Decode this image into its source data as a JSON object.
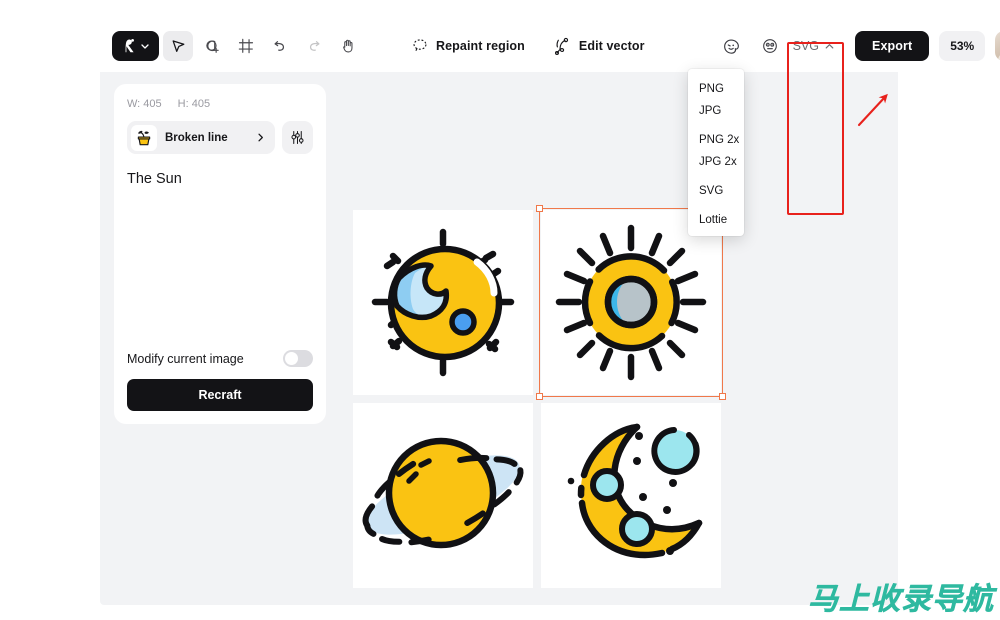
{
  "toolbar": {
    "logo_name": "recraft-logo",
    "tools": [
      {
        "name": "select-tool",
        "title": "Select",
        "active": true
      },
      {
        "name": "shape-tool",
        "title": "Add shape",
        "active": false
      },
      {
        "name": "frame-tool",
        "title": "Frame",
        "active": false
      },
      {
        "name": "undo-tool",
        "title": "Undo",
        "active": false
      },
      {
        "name": "redo-tool",
        "title": "Redo",
        "active": false
      },
      {
        "name": "hand-tool",
        "title": "Pan",
        "active": false
      }
    ],
    "repaint_label": "Repaint region",
    "edit_vector_label": "Edit vector",
    "format_label": "SVG",
    "export_label": "Export",
    "zoom_label": "53%"
  },
  "export_menu": {
    "items": [
      "PNG",
      "JPG",
      "PNG 2x",
      "JPG 2x",
      "SVG",
      "Lottie"
    ]
  },
  "panel": {
    "width_label": "W: 405",
    "height_label": "H: 405",
    "style_label": "Broken line",
    "prompt": "The Sun",
    "modify_label": "Modify current image",
    "recraft_label": "Recraft"
  },
  "canvas": {
    "images": [
      {
        "name": "image-sun-bitten",
        "alt": "Sun with blue crescent bite",
        "selected": false
      },
      {
        "name": "image-sun-ring",
        "alt": "Sun with grey-blue core",
        "selected": true
      },
      {
        "name": "image-saturn",
        "alt": "Saturn planet with ring",
        "selected": false
      },
      {
        "name": "image-moon",
        "alt": "Crescent moon with stars",
        "selected": false
      }
    ]
  },
  "annotation": {
    "highlight_color": "#e8211c",
    "arrow_color": "#e8211c"
  },
  "watermark": {
    "text": "马上收录导航",
    "color": "#2fb9a0"
  },
  "colors": {
    "accent_yellow": "#fac312",
    "accent_blue": "#4a9ef0",
    "light_blue": "#a8e4ef",
    "selection": "#f0784a",
    "app_bg": "#f2f3f5",
    "panel_bg": "#ffffff",
    "dark": "#131316"
  }
}
